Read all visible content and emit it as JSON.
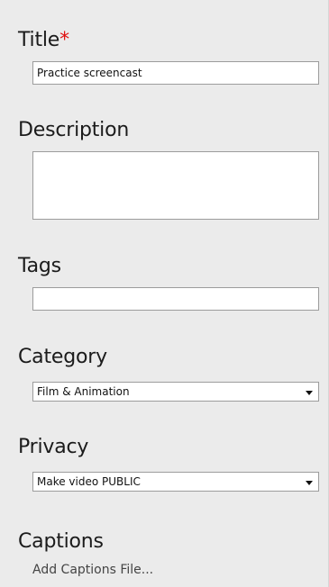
{
  "title_field": {
    "label": "Title",
    "required_mark": "*",
    "value": "Practice screencast"
  },
  "description_field": {
    "label": "Description",
    "value": ""
  },
  "tags_field": {
    "label": "Tags",
    "value": ""
  },
  "category_field": {
    "label": "Category",
    "selected": "Film & Animation"
  },
  "privacy_field": {
    "label": "Privacy",
    "selected": "Make video PUBLIC"
  },
  "captions": {
    "label": "Captions",
    "link_text": "Add Captions File..."
  },
  "colors": {
    "background": "#ebebeb",
    "required": "#e01010",
    "input_border": "#9c9c9c"
  },
  "icons": {
    "dropdown": "chevron-down-icon"
  }
}
